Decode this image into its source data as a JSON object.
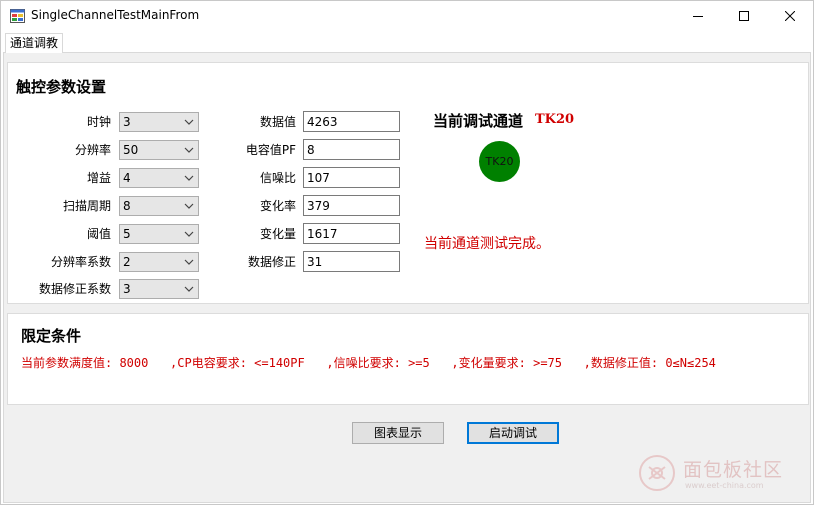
{
  "window": {
    "title": "SingleChannelTestMainFrom"
  },
  "tabs": [
    {
      "label": "通道调教",
      "selected": true
    }
  ],
  "touch_params": {
    "title": "触控参数设置",
    "left_fields": [
      {
        "label": "时钟",
        "value": "3"
      },
      {
        "label": "分辨率",
        "value": "50"
      },
      {
        "label": "增益",
        "value": "4"
      },
      {
        "label": "扫描周期",
        "value": "8"
      },
      {
        "label": "阈值",
        "value": "5"
      },
      {
        "label": "分辨率系数",
        "value": "2"
      },
      {
        "label": "数据修正系数",
        "value": "3"
      }
    ],
    "right_fields": [
      {
        "label": "数据值",
        "value": "4263"
      },
      {
        "label": "电容值PF",
        "value": "8"
      },
      {
        "label": "信噪比",
        "value": "107"
      },
      {
        "label": "变化率",
        "value": "379"
      },
      {
        "label": "变化量",
        "value": "1617"
      },
      {
        "label": "数据修正",
        "value": "31"
      }
    ]
  },
  "channel": {
    "label": "当前调试通道",
    "name": "TK20",
    "indicator_text": "TK20",
    "indicator_color": "#008000",
    "status": "当前通道测试完成。"
  },
  "conditions": {
    "title": "限定条件",
    "text": "当前参数满度值: 8000   ,CP电容要求: <=140PF   ,信噪比要求: >=5   ,变化量要求: >=75   ,数据修正值: 0≤N≤254"
  },
  "buttons": {
    "chart": "图表显示",
    "start": "启动调试"
  },
  "watermark": {
    "text": "面包板社区",
    "sub": "www.eet-china.com"
  },
  "colors": {
    "accent_red": "#d00000",
    "focus_blue": "#0078d7"
  }
}
